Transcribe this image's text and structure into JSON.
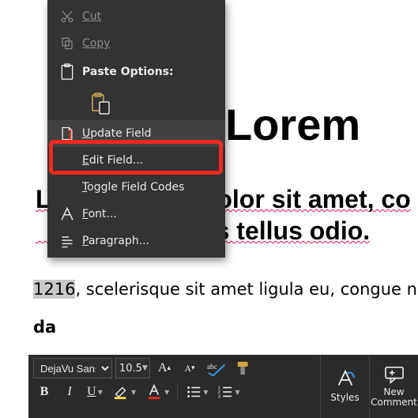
{
  "document": {
    "title": "Lorem",
    "subtitle_line1": "Lorem ipsum dolor sit amet, co",
    "subtitle_line2": "Nam tempus tellus odio.",
    "para_selected": "1216",
    "para_rest": ", scelerisque sit amet ligula eu, congue n",
    "para_cutoff": "da"
  },
  "context_menu": {
    "cut": "Cut",
    "copy": "Copy",
    "paste_options_header": "Paste Options:",
    "update_field": "Update Field",
    "edit_field": "Edit Field...",
    "toggle_field_codes": "Toggle Field Codes",
    "font": "Font...",
    "paragraph": "Paragraph..."
  },
  "minibar": {
    "font_name": "DejaVu Sans",
    "font_size": "10.5",
    "bold": "B",
    "italic": "I",
    "underline": "U",
    "styles": "Styles",
    "new_comment_l1": "New",
    "new_comment_l2": "Comment"
  }
}
